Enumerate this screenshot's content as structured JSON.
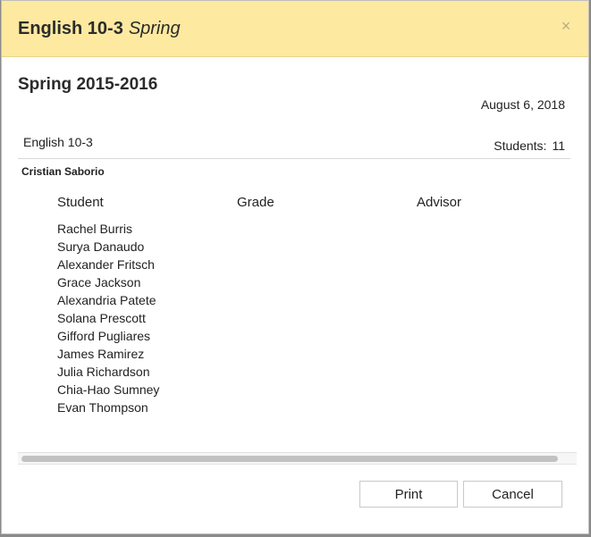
{
  "header": {
    "course": "English 10-3",
    "term": "Spring",
    "close_label": "×"
  },
  "report": {
    "term_title": "Spring 2015-2016",
    "date": "August 6, 2018",
    "course_name": "English 10-3",
    "students_label": "Students:",
    "students_count": "11",
    "teacher": "Cristian Saborio"
  },
  "table": {
    "columns": [
      "Student",
      "Grade",
      "Advisor"
    ],
    "students": [
      "Rachel Burris",
      "Surya Danaudo",
      "Alexander Fritsch",
      "Grace Jackson",
      "Alexandria Patete",
      "Solana Prescott",
      "Gifford Pugliares",
      "James Ramirez",
      "Julia Richardson",
      "Chia-Hao Sumney",
      "Evan Thompson"
    ]
  },
  "footer": {
    "print_label": "Print",
    "cancel_label": "Cancel"
  }
}
